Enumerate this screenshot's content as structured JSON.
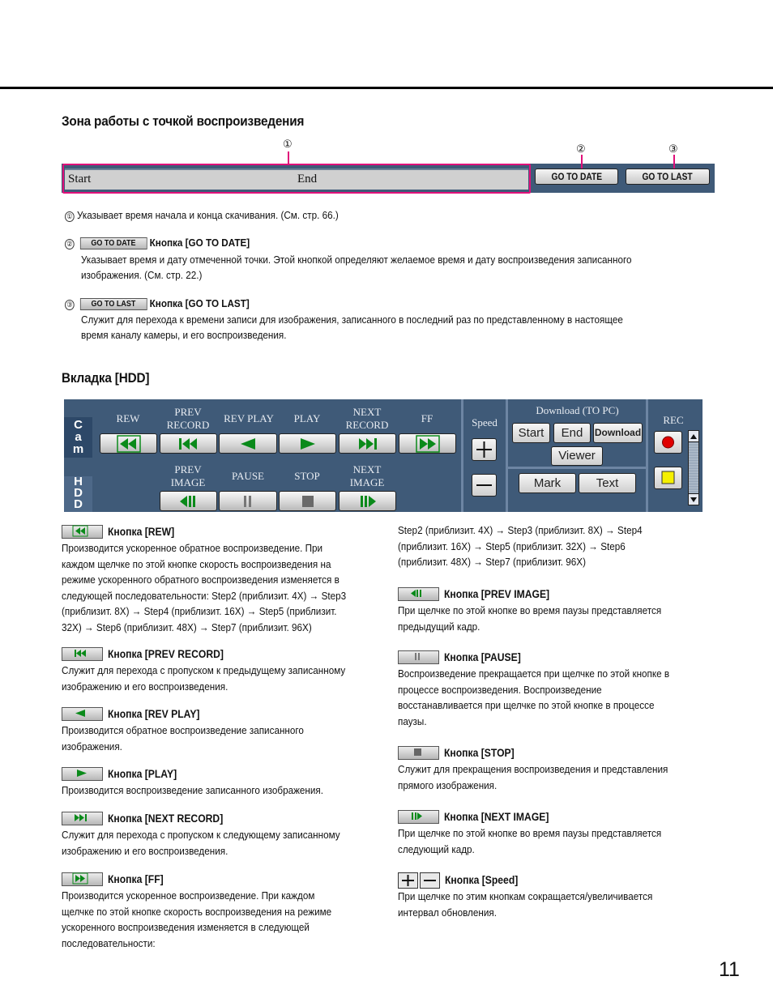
{
  "page_number": "11",
  "section1": {
    "title": "Зона работы с точкой воспроизведения",
    "callouts": [
      "①",
      "②",
      "③"
    ],
    "bar": {
      "start_label": "Start",
      "end_label": "End"
    },
    "go_to_date_label": "GO TO DATE",
    "go_to_last_label": "GO TO LAST",
    "items": [
      {
        "num": "①",
        "text": "Указывает время начала и конца скачивания. (См. стр. 66.)"
      },
      {
        "num": "②",
        "button": "GO TO DATE",
        "title": "Кнопка [GO TO DATE]",
        "lines": [
          "Указывает время и дату отмеченной точки. Этой кнопкой определяют желаемое время и дату воспроизведения записанного",
          "изображения. (См. стр. 22.)"
        ]
      },
      {
        "num": "③",
        "button": "GO TO LAST",
        "title": "Кнопка [GO TO LAST]",
        "lines": [
          "Служит для перехода к времени записи для изображения, записанного в последний раз по представленному в настоящее",
          "время каналу камеры, и его воспроизведения."
        ]
      }
    ]
  },
  "section2": {
    "title": "Вкладка [HDD]",
    "panel": {
      "tabs": [
        "Cam",
        "HDD"
      ],
      "row1": [
        {
          "label": "REW",
          "icon": "rewind-icon"
        },
        {
          "label": "PREV RECORD",
          "icon": "prev-record-icon"
        },
        {
          "label": "REV PLAY",
          "icon": "reverse-play-icon"
        },
        {
          "label": "PLAY",
          "icon": "play-icon"
        },
        {
          "label": "NEXT RECORD",
          "icon": "next-record-icon"
        },
        {
          "label": "FF",
          "icon": "fast-forward-icon"
        }
      ],
      "row2": [
        {
          "label": "PREV IMAGE",
          "icon": "prev-image-icon"
        },
        {
          "label": "PAUSE",
          "icon": "pause-icon"
        },
        {
          "label": "STOP",
          "icon": "stop-icon"
        },
        {
          "label": "NEXT IMAGE",
          "icon": "next-image-icon"
        }
      ],
      "speed_label": "Speed",
      "download_label": "Download (TO PC)",
      "download_buttons": [
        "Start",
        "End",
        "Download",
        "Viewer"
      ],
      "mark_label": "Mark",
      "text_label": "Text",
      "rec_label": "REC",
      "colors": {
        "panel": "#3f5a78",
        "icon_green": "#0a8a1a",
        "rec_red": "#e00000",
        "stop_yellow": "#f5f000"
      }
    },
    "left_items": [
      {
        "title": "Кнопка [REW]",
        "lines": [
          "Производится ускоренное обратное воспроизведение. При",
          "каждом щелчке по этой кнопке скорость воспроизведения на",
          "режиме ускоренного обратного воспроизведения изменяется в",
          "следующей последовательности: Step2 (приблизит. 4X) → Step3",
          "(приблизит. 8X) → Step4 (приблизит. 16X) → Step5 (приблизит.",
          "32X) → Step6 (приблизит. 48X) → Step7 (приблизит. 96X)"
        ]
      },
      {
        "title": "Кнопка [PREV RECORD]",
        "lines": [
          "Служит для перехода с пропуском к предыдущему записанному",
          "изображению и его воспроизведения."
        ]
      },
      {
        "title": "Кнопка [REV PLAY]",
        "lines": [
          "Производится обратное воспроизведение записанного",
          "изображения."
        ]
      },
      {
        "title": "Кнопка [PLAY]",
        "lines": [
          "Производится воспроизведение записанного изображения."
        ]
      },
      {
        "title": "Кнопка [NEXT RECORD]",
        "lines": [
          "Служит для перехода с пропуском к следующему записанному",
          "изображению и его воспроизведения."
        ]
      },
      {
        "title": "Кнопка [FF]",
        "lines": [
          "Производится ускоренное воспроизведение. При каждом",
          "щелчке по этой кнопке скорость воспроизведения на режиме",
          "ускоренного воспроизведения изменяется в следующей",
          "последовательности:"
        ]
      }
    ],
    "right_continuation": [
      "Step2 (приблизит. 4X) → Step3 (приблизит. 8X) → Step4",
      "(приблизит. 16X) → Step5 (приблизит. 32X) → Step6",
      "(приблизит. 48X) → Step7 (приблизит. 96X)"
    ],
    "right_items": [
      {
        "title": "Кнопка [PREV IMAGE]",
        "lines": [
          "При щелчке по этой кнопке во время паузы представляется",
          "предыдущий кадр."
        ]
      },
      {
        "title": "Кнопка [PAUSE]",
        "lines": [
          "Воспроизведение прекращается при щелчке по этой кнопке в",
          "процессе воспроизведения. Воспроизведение",
          "восстанавливается при щелчке по этой кнопке в процессе",
          "паузы."
        ]
      },
      {
        "title": "Кнопка [STOP]",
        "lines": [
          "Служит для прекращения воспроизведения и представления",
          "прямого изображения."
        ]
      },
      {
        "title": "Кнопка [NEXT IMAGE]",
        "lines": [
          "При щелчке по этой кнопке во время паузы представляется",
          "следующий кадр."
        ]
      },
      {
        "title": "Кнопка [Speed]",
        "lines": [
          "При щелчке по этим кнопкам сокращается/увеличивается",
          "интервал обновления."
        ]
      }
    ]
  }
}
